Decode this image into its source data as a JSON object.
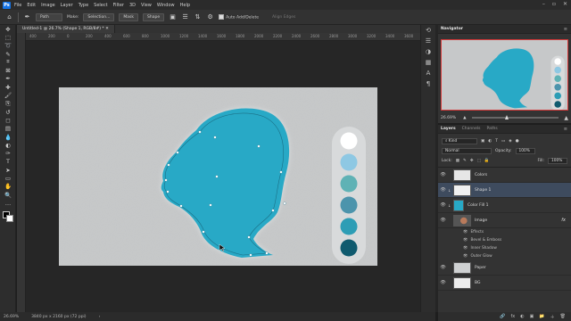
{
  "menu": [
    "File",
    "Edit",
    "Image",
    "Layer",
    "Type",
    "Select",
    "Filter",
    "3D",
    "View",
    "Window",
    "Help"
  ],
  "app_logo": "Ps",
  "window_controls": [
    "–",
    "▫",
    "✕"
  ],
  "options": {
    "tool_mode": "Path",
    "make_label": "Make:",
    "selection_btn": "Selection...",
    "mask_btn": "Mask",
    "shape_btn": "Shape",
    "auto_add_delete": "Auto Add/Delete",
    "align_edges": "Align Edges"
  },
  "document": {
    "tab_title": "Untitled-1 @ 26.7% (Shape 1, RGB/8#) *",
    "ruler_labels": [
      "400",
      "200",
      "0",
      "200",
      "400",
      "600",
      "800",
      "1000",
      "1200",
      "1400",
      "1600",
      "1800",
      "2000",
      "2200",
      "2400",
      "2600",
      "2800",
      "3000",
      "3200",
      "3400",
      "3600",
      "3800"
    ]
  },
  "colors": {
    "silhouette": "#28a9c6",
    "swatches": [
      "#ffffff",
      "#8ec8e3",
      "#5fb2b5",
      "#4c94ac",
      "#2d9db5",
      "#0f5a6e"
    ]
  },
  "status": {
    "zoom": "26.69%",
    "doc_size": "3840 px x 2160 px (72 ppi)"
  },
  "navigator": {
    "tabs": [
      "Navigator"
    ],
    "zoom": "26.69%"
  },
  "layers": {
    "tabs": [
      "Layers",
      "Channels",
      "Paths"
    ],
    "kind_label": "Kind",
    "blend_mode": "Normal",
    "opacity_label": "Opacity:",
    "opacity_value": "100%",
    "lock_label": "Lock:",
    "fill_label": "Fill:",
    "fill_value": "100%",
    "items": [
      {
        "name": "Colors"
      },
      {
        "name": "Shape 1"
      },
      {
        "name": "Color Fill 1"
      },
      {
        "name": "Image",
        "fx": "fx"
      },
      {
        "name": "Paper"
      },
      {
        "name": "BG"
      }
    ],
    "effects_label": "Effects",
    "effects": [
      "Bevel & Emboss",
      "Inner Shadow",
      "Outer Glow"
    ],
    "footer_icons": [
      "🔗",
      "fx",
      "◐",
      "▣",
      "📁",
      "＋",
      "🗑"
    ]
  },
  "tools": [
    "move-tool",
    "marquee-tool",
    "lasso-tool",
    "quick-select-tool",
    "crop-tool",
    "frame-tool",
    "eyedropper-tool",
    "healing-tool",
    "brush-tool",
    "stamp-tool",
    "history-brush-tool",
    "eraser-tool",
    "gradient-tool",
    "blur-tool",
    "dodge-tool",
    "pen-tool",
    "type-tool",
    "path-select-tool",
    "shape-tool",
    "hand-tool",
    "zoom-tool",
    "more-tools"
  ],
  "tool_glyphs": [
    "✥",
    "⬚",
    "➰",
    "✎",
    "⌗",
    "⊠",
    "✒",
    "✚",
    "🖌",
    "⎘",
    "↺",
    "◻",
    "▤",
    "💧",
    "◐",
    "✑",
    "T",
    "➤",
    "▭",
    "✋",
    "🔍",
    "…"
  ]
}
